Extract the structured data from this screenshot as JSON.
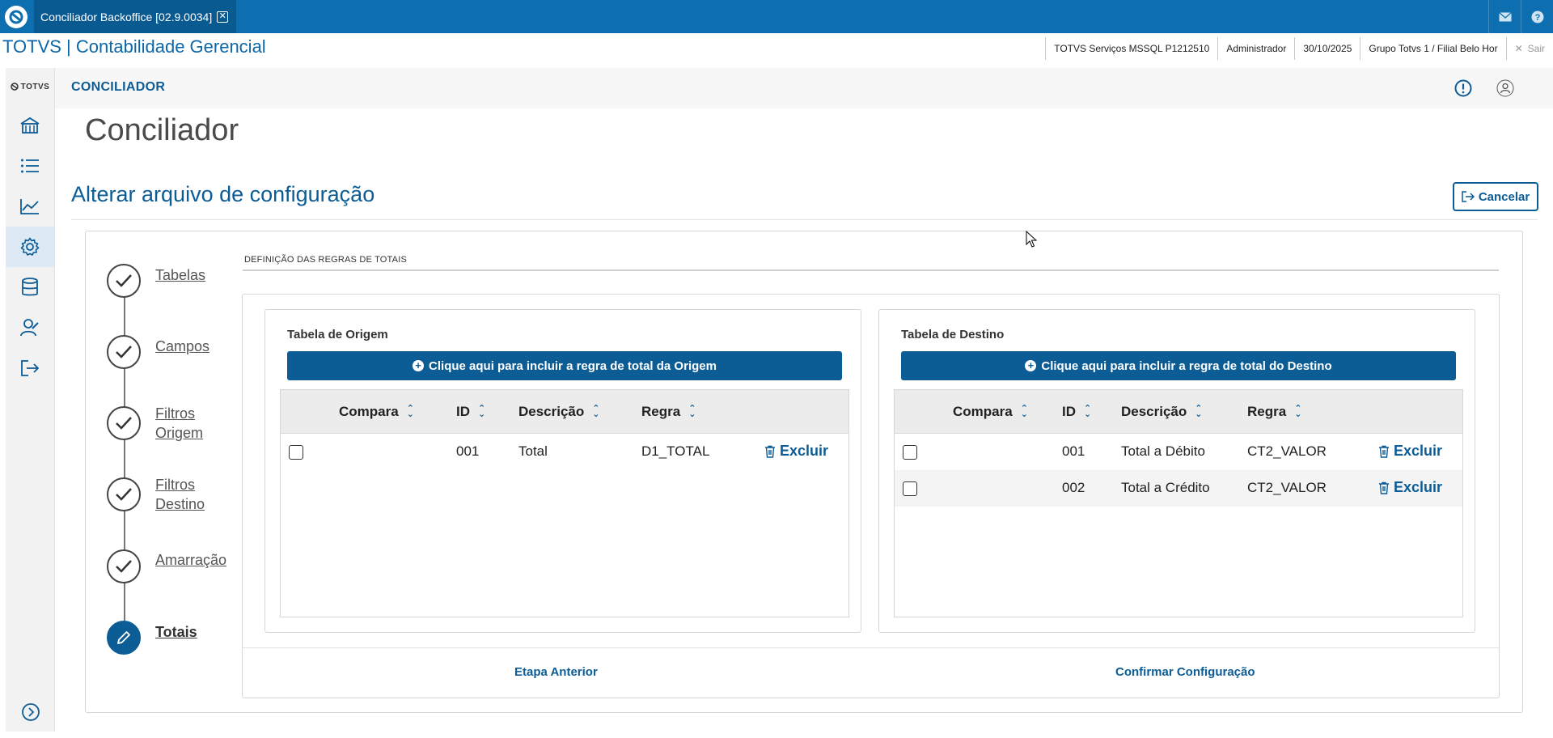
{
  "window": {
    "tab_title": "Conciliador Backoffice [02.9.0034]"
  },
  "header": {
    "brand": "TOTVS | Contabilidade Gerencial",
    "environment": "TOTVS Serviços MSSQL P1212510",
    "user": "Administrador",
    "date": "30/10/2025",
    "company": "Grupo Totvs 1 / Filial Belo Hor",
    "logout": "Sair"
  },
  "sidebar": {
    "logo_text": "TOTVS",
    "items": [
      "home-icon",
      "list-icon",
      "chart-icon",
      "gear-icon",
      "database-icon",
      "user-edit-icon",
      "logout-icon"
    ],
    "active_index": 3
  },
  "module": {
    "title": "CONCILIADOR"
  },
  "page": {
    "title": "Conciliador",
    "subtitle": "Alterar arquivo de configuração",
    "cancel_label": "Cancelar"
  },
  "stepper": {
    "steps": [
      {
        "line1": "Tabelas",
        "line2": ""
      },
      {
        "line1": "Campos",
        "line2": ""
      },
      {
        "line1": "Filtros",
        "line2": "Origem"
      },
      {
        "line1": "Filtros",
        "line2": "Destino"
      },
      {
        "line1": "Amarração",
        "line2": ""
      },
      {
        "line1": "Totais",
        "line2": ""
      }
    ]
  },
  "section": {
    "label": "DEFINIÇÃO DAS REGRAS DE TOTAIS"
  },
  "origem": {
    "title": "Tabela de Origem",
    "add_label": "Clique aqui para incluir a regra de total da Origem",
    "columns": [
      "Compara",
      "ID",
      "Descrição",
      "Regra"
    ],
    "rows": [
      {
        "id": "001",
        "descricao": "Total",
        "regra": "D1_TOTAL",
        "action": "Excluir"
      }
    ]
  },
  "destino": {
    "title": "Tabela de Destino",
    "add_label": "Clique aqui para incluir a regra de total do Destino",
    "columns": [
      "Compara",
      "ID",
      "Descrição",
      "Regra"
    ],
    "rows": [
      {
        "id": "001",
        "descricao": "Total a Débito",
        "regra": "CT2_VALOR",
        "action": "Excluir"
      },
      {
        "id": "002",
        "descricao": "Total a Crédito",
        "regra": "CT2_VALOR",
        "action": "Excluir"
      }
    ]
  },
  "footer": {
    "prev_label": "Etapa Anterior",
    "confirm_label": "Confirmar Configuração"
  }
}
